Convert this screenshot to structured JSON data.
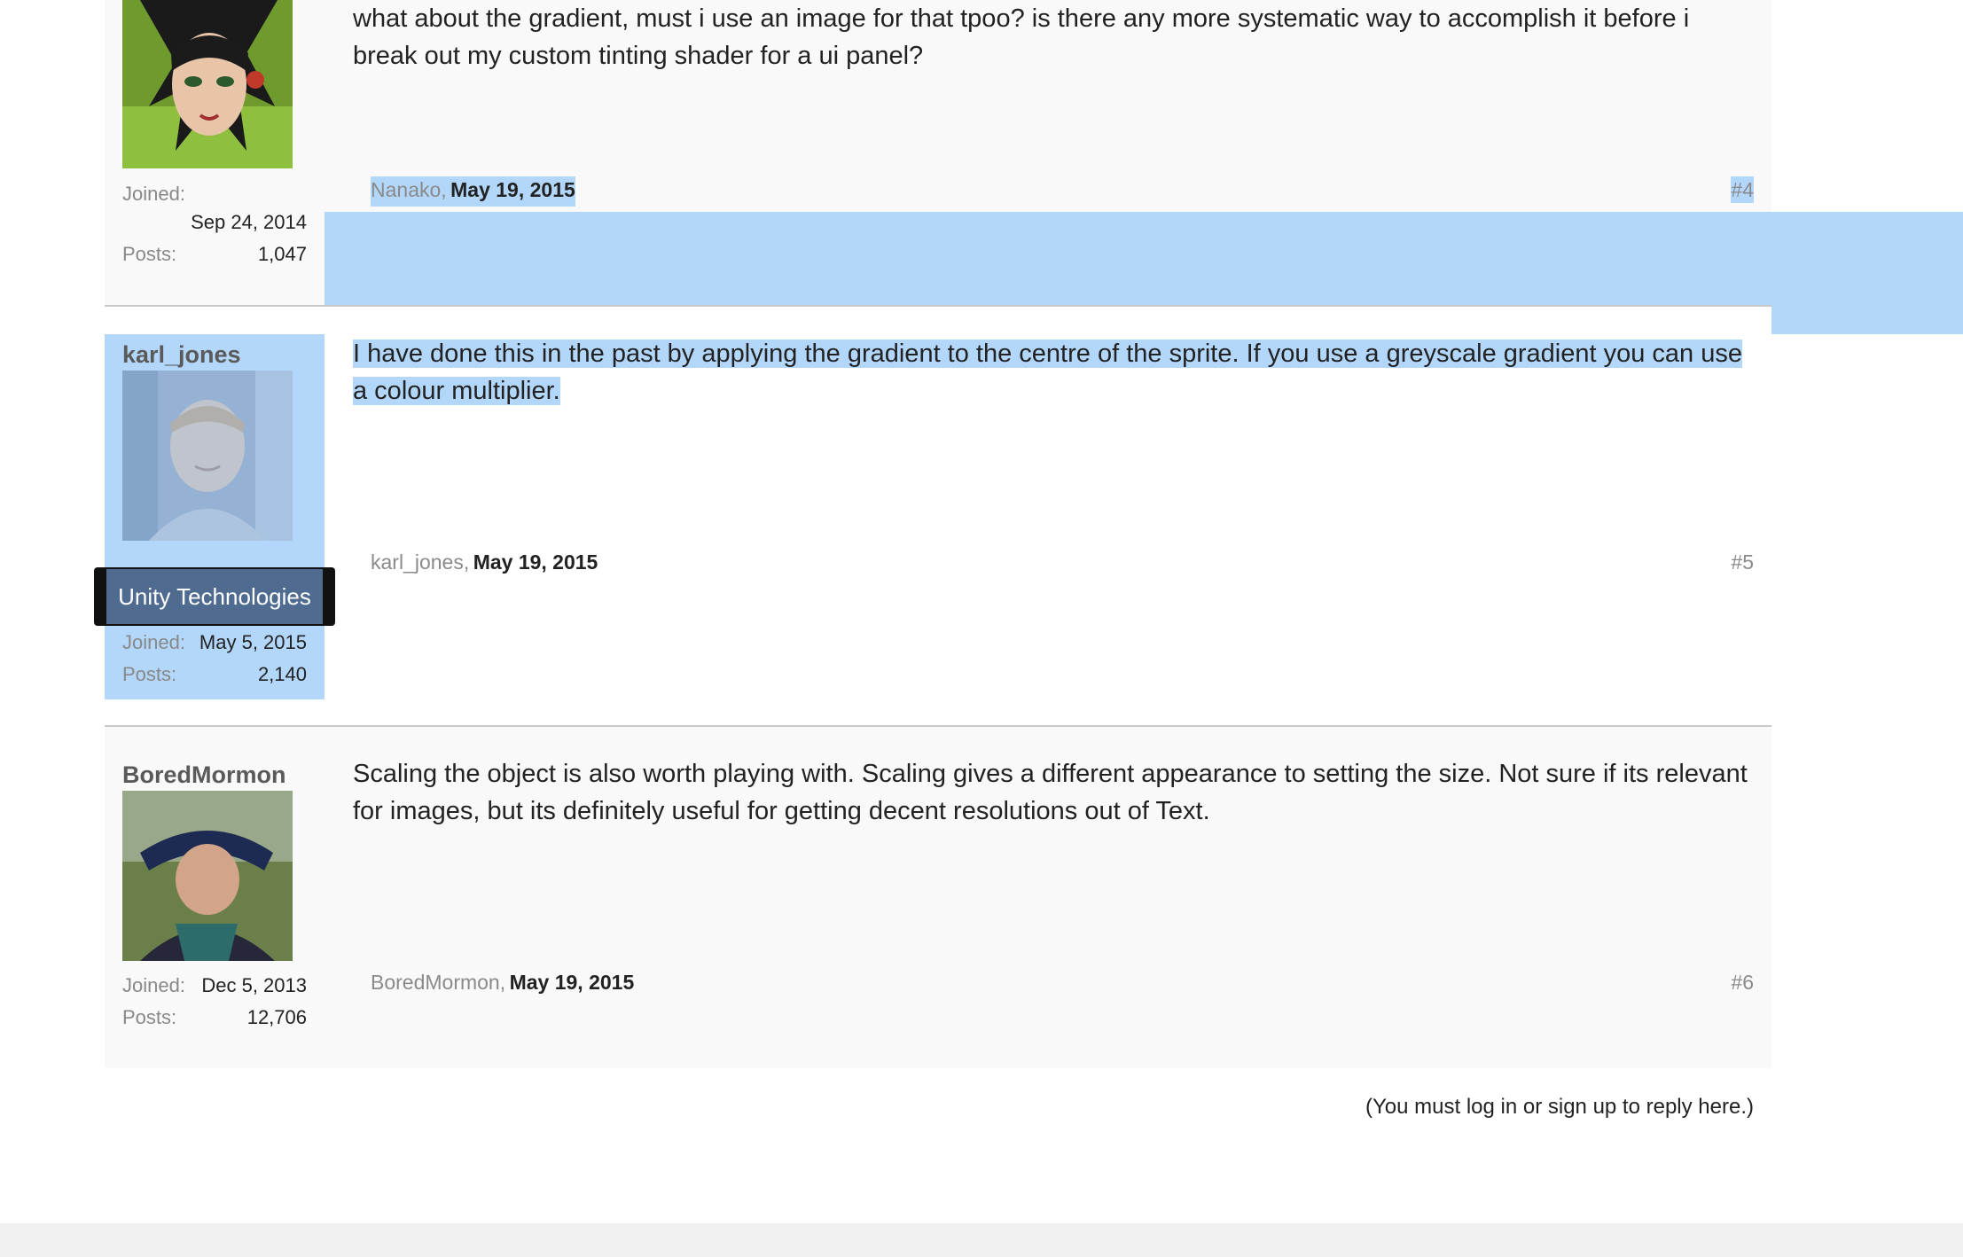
{
  "posts": [
    {
      "author": "Nanako",
      "message": "what about the gradient, must i use an image for that tpoo? is there any more systematic way to accomplish it before i break out my custom tinting shader for a ui panel?",
      "footer_author": "Nanako,",
      "date": "May 19, 2015",
      "post_number": "#4",
      "joined_label": "Joined:",
      "joined": "Sep 24, 2014",
      "posts_label": "Posts:",
      "posts": "1,047",
      "avatar": "anime-girl-avatar"
    },
    {
      "author": "karl_jones",
      "message": "I have done this in the past by applying the gradient to the centre of the sprite. If you use a greyscale gradient you can use a colour multiplier.",
      "footer_author": "karl_jones,",
      "date": "May 19, 2015",
      "post_number": "#5",
      "badge": "Unity Technologies",
      "joined_label": "Joined:",
      "joined": "May 5, 2015",
      "posts_label": "Posts:",
      "posts": "2,140",
      "avatar": "man-portrait-avatar"
    },
    {
      "author": "BoredMormon",
      "message": "Scaling the object is also worth playing with. Scaling gives a different appearance to setting the size. Not sure if its relevant for images, but its definitely useful for getting decent resolutions out of Text.",
      "footer_author": "BoredMormon,",
      "date": "May 19, 2015",
      "post_number": "#6",
      "joined_label": "Joined:",
      "joined": "Dec 5, 2013",
      "posts_label": "Posts:",
      "posts": "12,706",
      "avatar": "man-outdoor-avatar"
    }
  ],
  "reply_notice": "(You must log in or sign up to reply here.)",
  "colors": {
    "selection": "#b3d7fa",
    "panel": "#f9f9f9",
    "badge": "#4f6b8f"
  }
}
